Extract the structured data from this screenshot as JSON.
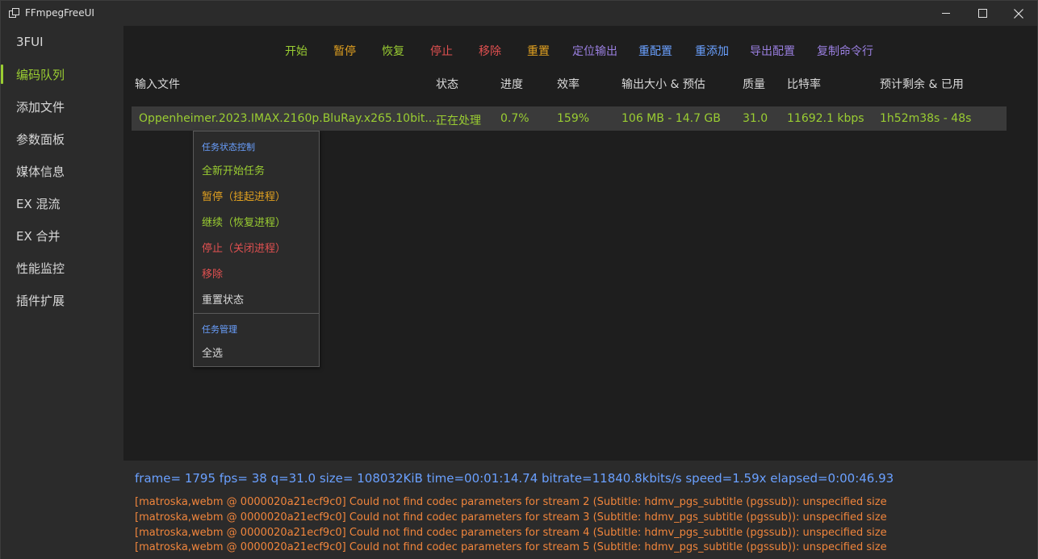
{
  "window": {
    "title": "FFmpegFreeUI"
  },
  "sidebar": {
    "items": [
      {
        "label": "3FUI"
      },
      {
        "label": "编码队列"
      },
      {
        "label": "添加文件"
      },
      {
        "label": "参数面板"
      },
      {
        "label": "媒体信息"
      },
      {
        "label": "EX 混流"
      },
      {
        "label": "EX 合并"
      },
      {
        "label": "性能监控"
      },
      {
        "label": "插件扩展"
      }
    ],
    "active_index": 1
  },
  "toolbar": {
    "buttons": [
      {
        "label": "开始",
        "color": "#9acd32"
      },
      {
        "label": "暂停",
        "color": "#e0a020"
      },
      {
        "label": "恢复",
        "color": "#9acd32"
      },
      {
        "label": "停止",
        "color": "#e05050"
      },
      {
        "label": "移除",
        "color": "#e05050"
      },
      {
        "label": "重置",
        "color": "#e0a020"
      },
      {
        "label": "定位输出",
        "color": "#9a7fe0"
      },
      {
        "label": "重配置",
        "color": "#6aa0ff"
      },
      {
        "label": "重添加",
        "color": "#6aa0ff"
      },
      {
        "label": "导出配置",
        "color": "#9a7fe0"
      },
      {
        "label": "复制命令行",
        "color": "#9a7fe0"
      }
    ]
  },
  "table": {
    "headers": [
      "输入文件",
      "状态",
      "进度",
      "效率",
      "输出大小 & 预估",
      "质量",
      "比特率",
      "预计剩余 & 已用"
    ],
    "rows": [
      [
        "Oppenheimer.2023.IMAX.2160p.BluRay.x265.10bit....",
        "正在处理",
        "0.7%",
        "159%",
        "106 MB - 14.7 GB",
        "31.0",
        "11692.1 kbps",
        "1h52m38s - 48s"
      ]
    ]
  },
  "context_menu": {
    "section1_title": "任务状态控制",
    "section1_items": [
      {
        "label": "全新开始任务",
        "color": "#9acd32"
      },
      {
        "label": "暂停（挂起进程）",
        "color": "#e0a020"
      },
      {
        "label": "继续（恢复进程）",
        "color": "#9acd32"
      },
      {
        "label": "停止（关闭进程）",
        "color": "#e05050"
      },
      {
        "label": "移除",
        "color": "#e05050"
      },
      {
        "label": "重置状态",
        "color": "#d8d8d8"
      }
    ],
    "section2_title": "任务管理",
    "section2_items": [
      {
        "label": "全选",
        "color": "#d8d8d8"
      }
    ]
  },
  "log": {
    "progress": "frame= 1795 fps= 38 q=31.0 size=  108032KiB time=00:01:14.74 bitrate=11840.8kbits/s speed=1.59x elapsed=0:00:46.93",
    "lines": [
      "[matroska,webm @ 0000020a21ecf9c0] Could not find codec parameters for stream 2 (Subtitle: hdmv_pgs_subtitle (pgssub)): unspecified size",
      "[matroska,webm @ 0000020a21ecf9c0] Could not find codec parameters for stream 3 (Subtitle: hdmv_pgs_subtitle (pgssub)): unspecified size",
      "[matroska,webm @ 0000020a21ecf9c0] Could not find codec parameters for stream 4 (Subtitle: hdmv_pgs_subtitle (pgssub)): unspecified size",
      "[matroska,webm @ 0000020a21ecf9c0] Could not find codec parameters for stream 5 (Subtitle: hdmv_pgs_subtitle (pgssub)): unspecified size"
    ]
  },
  "colors": {
    "accent_green": "#9acd32",
    "accent_blue": "#6aa0ff",
    "log_orange": "#f0853c",
    "row_background": "#3a3a3a"
  }
}
